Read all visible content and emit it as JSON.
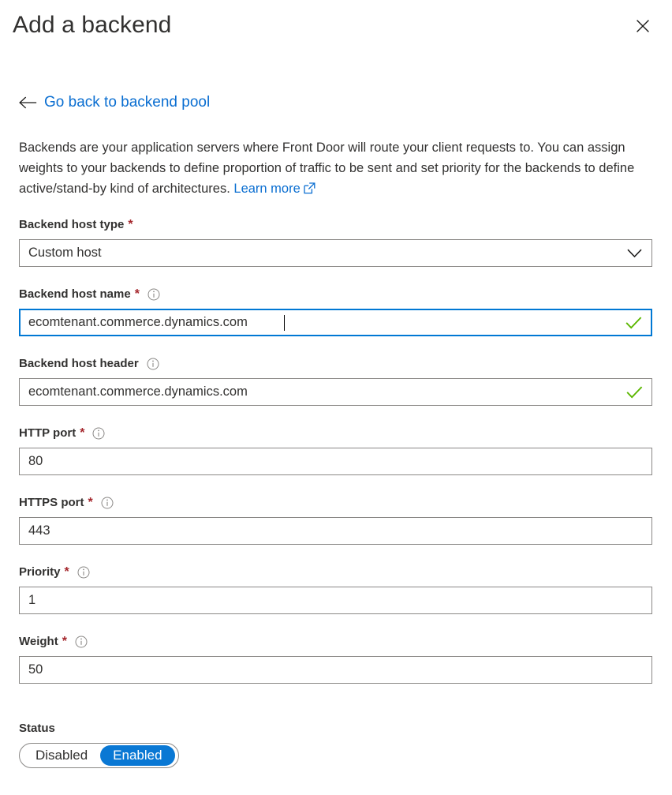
{
  "blade": {
    "title": "Add a backend",
    "close_icon": "close-icon"
  },
  "back_link": {
    "arrow_icon": "arrow-left-icon",
    "label": "Go back to backend pool"
  },
  "description": {
    "text": "Backends are your application servers where Front Door will route your client requests to. You can assign weights to your backends to define proportion of traffic to be sent and set priority for the backends to define active/stand-by kind of architectures. ",
    "learn_more_label": "Learn more",
    "external_icon": "external-link-icon"
  },
  "fields": {
    "backend_host_type": {
      "label": "Backend host type",
      "required_marker": "*",
      "value": "Custom host",
      "chevron_icon": "chevron-down-icon"
    },
    "backend_host_name": {
      "label": "Backend host name",
      "required_marker": "*",
      "info_icon": "info-icon",
      "value": "ecomtenant.commerce.dynamics.com",
      "valid_icon": "checkmark-icon"
    },
    "backend_host_header": {
      "label": "Backend host header",
      "info_icon": "info-icon",
      "value": "ecomtenant.commerce.dynamics.com",
      "valid_icon": "checkmark-icon"
    },
    "http_port": {
      "label": "HTTP port",
      "required_marker": "*",
      "info_icon": "info-icon",
      "value": "80"
    },
    "https_port": {
      "label": "HTTPS port",
      "required_marker": "*",
      "info_icon": "info-icon",
      "value": "443"
    },
    "priority": {
      "label": "Priority",
      "required_marker": "*",
      "info_icon": "info-icon",
      "value": "1"
    },
    "weight": {
      "label": "Weight",
      "required_marker": "*",
      "info_icon": "info-icon",
      "value": "50"
    },
    "status": {
      "label": "Status",
      "options": [
        {
          "label": "Disabled",
          "selected": false
        },
        {
          "label": "Enabled",
          "selected": true
        }
      ]
    }
  },
  "colors": {
    "link_blue": "#0a6ed1",
    "focus_blue": "#0078d4",
    "toggle_blue": "#0a78d4",
    "required_red": "#a4262c",
    "valid_green": "#5bb700",
    "border_gray": "#8a8886",
    "text_dark": "#323130"
  }
}
